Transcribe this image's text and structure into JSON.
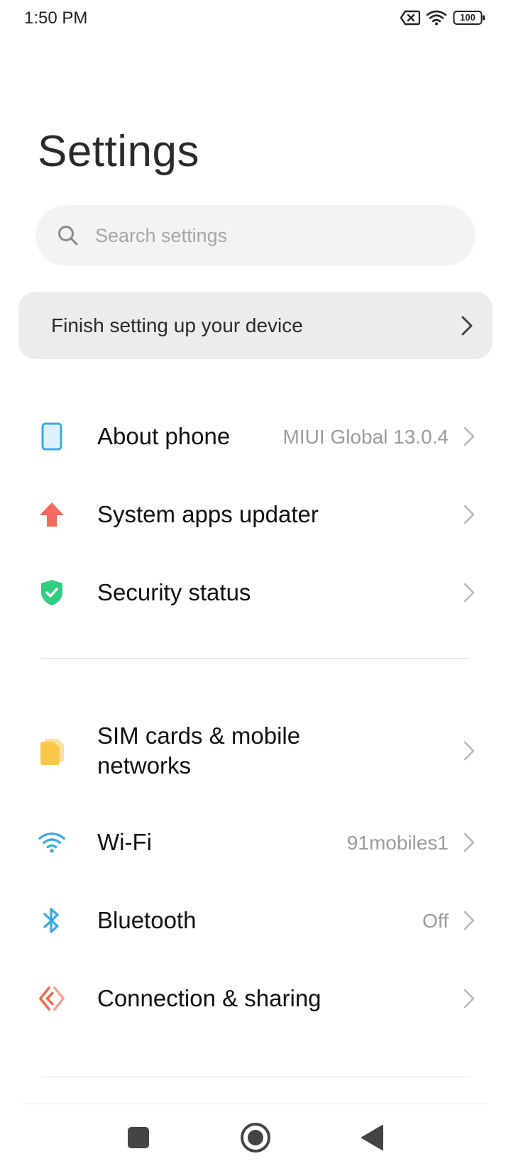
{
  "status_bar": {
    "time": "1:50 PM",
    "battery": "100",
    "icons": [
      "no-sim-icon",
      "wifi-icon",
      "battery-icon"
    ]
  },
  "page": {
    "title": "Settings"
  },
  "search": {
    "placeholder": "Search settings",
    "value": ""
  },
  "setup_banner": {
    "label": "Finish setting up your device"
  },
  "settings": {
    "items": [
      {
        "label": "About phone",
        "value": "MIUI Global 13.0.4",
        "icon": "phone-icon",
        "color": "#3aa8e8"
      },
      {
        "label": "System apps updater",
        "value": "",
        "icon": "arrow-up-icon",
        "color": "#f26a5b"
      },
      {
        "label": "Security status",
        "value": "",
        "icon": "shield-check-icon",
        "color": "#2ecf7f"
      },
      {
        "label": "SIM cards & mobile networks",
        "value": "",
        "icon": "sim-card-icon",
        "color": "#f8c84a"
      },
      {
        "label": "Wi-Fi",
        "value": "91mobiles1",
        "icon": "wifi-icon",
        "color": "#3aa8e8"
      },
      {
        "label": "Bluetooth",
        "value": "Off",
        "icon": "bluetooth-icon",
        "color": "#3aa8e8"
      },
      {
        "label": "Connection & sharing",
        "value": "",
        "icon": "connection-sharing-icon",
        "color": "#f06a4e"
      }
    ]
  },
  "nav": {
    "buttons": [
      "recents-button",
      "home-button",
      "back-button"
    ]
  }
}
